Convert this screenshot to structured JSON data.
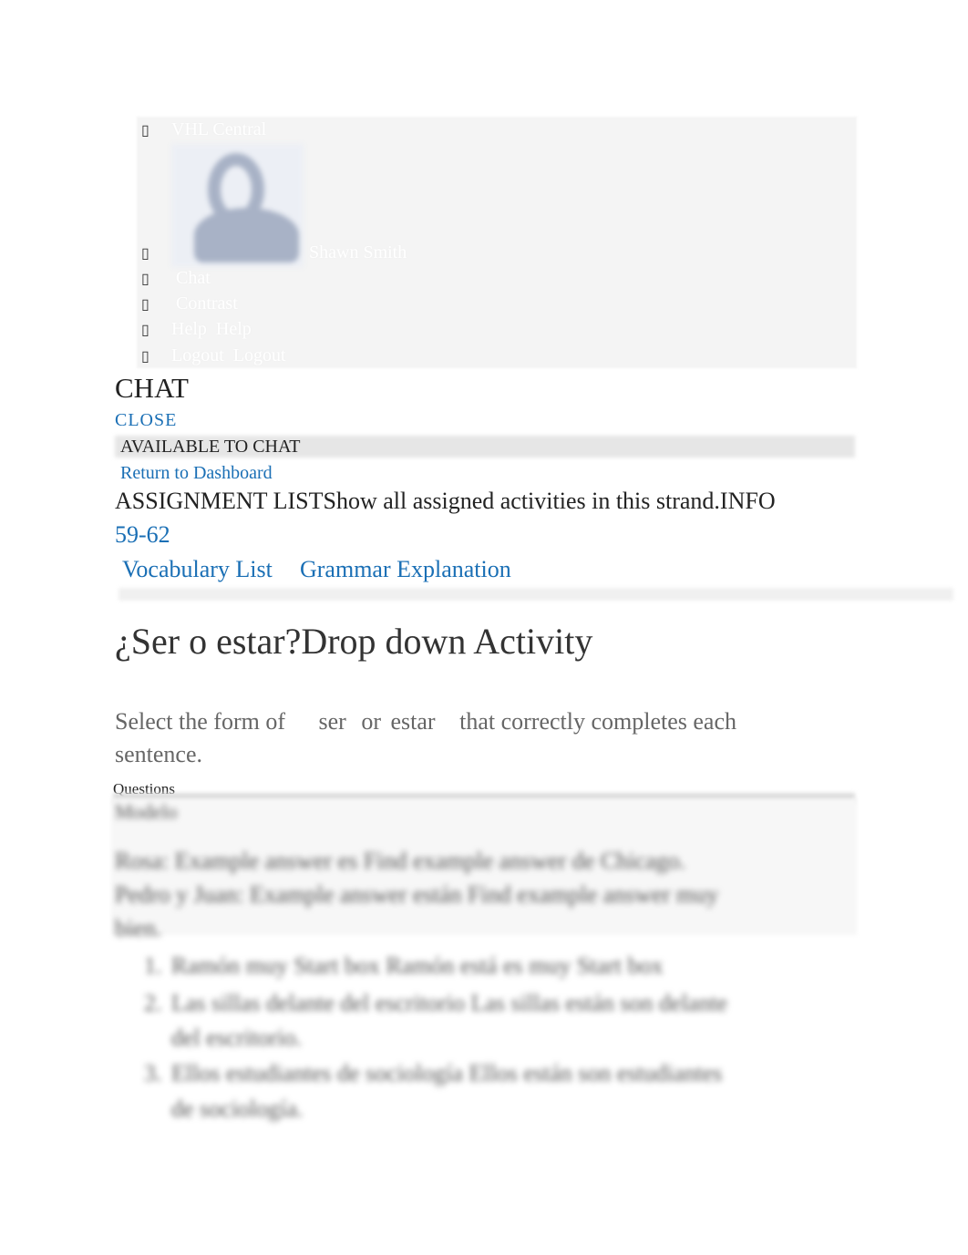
{
  "nav": {
    "brand": "VHL Central",
    "user_name": "Shawn Smith",
    "items": [
      {
        "label": "Chat"
      },
      {
        "label": "Contrast"
      },
      {
        "label": "Help",
        "label2": "Help"
      },
      {
        "label": "Logout",
        "label2": "Logout"
      }
    ],
    "bullet_glyph": "▯"
  },
  "chat": {
    "title": "CHAT",
    "close": "CLOSE",
    "available": "AVAILABLE TO CHAT",
    "return": "Return to Dashboard"
  },
  "assignment": {
    "label": "ASSIGNMENT LISTShow all assigned activities in this strand.INFO",
    "pages": "59-62",
    "vocab": "Vocabulary List",
    "grammar": "Grammar Explanation"
  },
  "activity": {
    "title": "¿Ser o estar?Drop down Activity",
    "instr_1": "Select the form of",
    "instr_ser": "ser",
    "instr_or": "or",
    "instr_estar": "estar",
    "instr_2": "that correctly completes each",
    "instr_3": "sentence.",
    "questions_label": "Questions",
    "model_label": "Modelo",
    "model_line1": "Rosa: Example answer      es Find example answer        de Chicago.",
    "model_line2": "Pedro y Juan:   Example answer      están   Find example answer        muy",
    "model_line3": "bien.",
    "items": [
      {
        "num": "1.",
        "text": "Ramón muy Start box Ramón está es muy Start box"
      },
      {
        "num": "2.",
        "text": "Las sillas delante del escritorio Las sillas están son delante",
        "text2": "del escritorio."
      },
      {
        "num": "3.",
        "text": "Ellos estudiantes de sociología Ellos están son estudiantes",
        "text2": "de sociología."
      }
    ]
  },
  "colors": {
    "link": "#1a6fb5",
    "nav_bg": "#f4f4f4"
  }
}
